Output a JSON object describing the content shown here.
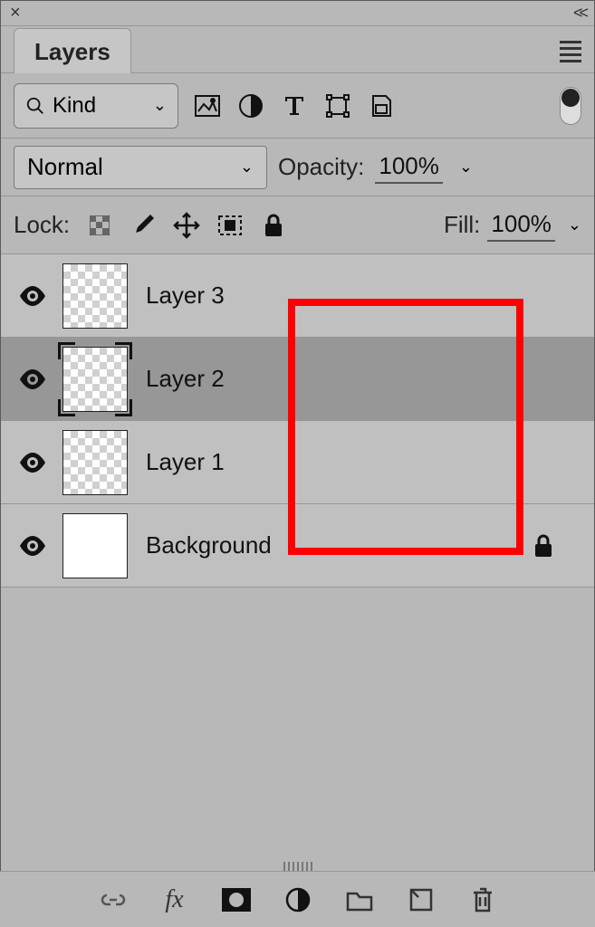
{
  "titlebar": {
    "close": "×",
    "collapse": "<<"
  },
  "tabbar": {
    "active_tab": "Layers"
  },
  "filter": {
    "kind_label": "Kind"
  },
  "blend": {
    "mode": "Normal",
    "opacity_label": "Opacity:",
    "opacity_value": "100%"
  },
  "lock": {
    "label": "Lock:",
    "fill_label": "Fill:",
    "fill_value": "100%"
  },
  "layers": [
    {
      "name": "Layer 3",
      "thumb": "checker",
      "selected": false,
      "locked": false
    },
    {
      "name": "Layer 2",
      "thumb": "checker",
      "selected": true,
      "locked": false
    },
    {
      "name": "Layer 1",
      "thumb": "checker",
      "selected": false,
      "locked": false
    },
    {
      "name": "Background",
      "thumb": "white",
      "selected": false,
      "locked": true
    }
  ]
}
